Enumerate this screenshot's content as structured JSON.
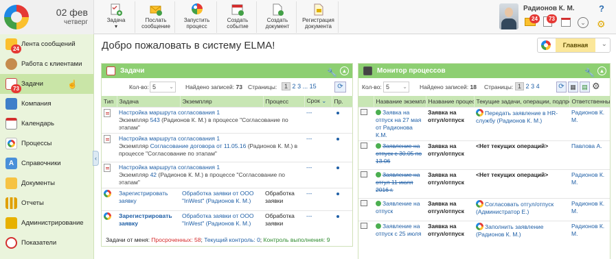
{
  "header": {
    "date_day": "02 фев",
    "date_weekday": "четверг",
    "tools": [
      {
        "label": "Задача",
        "sub": "▾"
      },
      {
        "label": "Послать сообщение"
      },
      {
        "label": "Запустить процесс"
      },
      {
        "label": "Создать событие"
      },
      {
        "label": "Создать документ"
      },
      {
        "label": "Регистрация документа"
      }
    ],
    "user_name": "Радионов К. М.",
    "badges": {
      "messages": "24",
      "tasks": "73"
    },
    "help": "?"
  },
  "sidebar": {
    "items": [
      {
        "label": "Лента сообщений",
        "badge": "24"
      },
      {
        "label": "Работа с клиентами"
      },
      {
        "label": "Задачи",
        "badge": "73"
      },
      {
        "label": "Компания"
      },
      {
        "label": "Календарь"
      },
      {
        "label": "Процессы"
      },
      {
        "label": "Справочники"
      },
      {
        "label": "Документы"
      },
      {
        "label": "Отчеты"
      },
      {
        "label": "Администрирование"
      },
      {
        "label": "Показатели"
      }
    ]
  },
  "main": {
    "welcome": "Добро пожаловать в систему ELMA!",
    "home_label": "Главная"
  },
  "tasks_panel": {
    "title": "Задачи",
    "count_label": "Кол-во:",
    "count_value": "5",
    "found_label": "Найдено записей:",
    "found_value": "73",
    "pages_label": "Страницы:",
    "pages": [
      "1",
      "2",
      "3",
      "...",
      "15"
    ],
    "columns": [
      "Тип",
      "Задача",
      "Экземпляр",
      "Процесс",
      "Срок",
      "Пр."
    ],
    "rows": [
      {
        "task": "Настройка маршрута согласования 1",
        "detail_pre": "Экземпляр ",
        "detail_link": "543",
        "detail_mid": " (Радионов К. М.) в процессе \"Согласование по этапам\"",
        "instance": "",
        "process": "",
        "term": "---"
      },
      {
        "task": "Настройка маршрута согласования 1",
        "detail_pre": "Экземпляр ",
        "detail_link": "Согласование договора от 11.05.16",
        "detail_mid": " (Радионов К. М.) в процессе \"Согласование по этапам\"",
        "instance": "",
        "process": "",
        "term": "---"
      },
      {
        "task": "Настройка маршрута согласования 1",
        "detail_pre": "Экземпляр ",
        "detail_link": "42",
        "detail_mid": " (Радионов К. М.) в процессе \"Согласование по этапам\"",
        "instance": "",
        "process": "",
        "term": "---"
      },
      {
        "task": "Зарегистрировать заявку",
        "instance": "Обработка заявки от ООО \"InWest\" (Радионов К. М.)",
        "process": "Обработка заявки",
        "term": "---"
      },
      {
        "task": "Зарегистрировать заявку",
        "instance": "Обработка заявки от ООО \"InWest\" (Радионов К. М.)",
        "process": "Обработка заявки",
        "term": "---"
      }
    ],
    "footer": {
      "prefix": "Задачи от меня: ",
      "overdue": "Просроченных: 58",
      "control": "Текущий контроль: 0",
      "done": "Контроль выполнения: 9"
    }
  },
  "monitor_panel": {
    "title": "Монитор процессов",
    "count_label": "Кол-во:",
    "count_value": "5",
    "found_label": "Найдено записей:",
    "found_value": "18",
    "pages_label": "Страницы:",
    "pages": [
      "1",
      "2",
      "3",
      "4"
    ],
    "columns": [
      "Название экземпляра",
      "Название процесса",
      "Текущие задачи, операции, подпроцессы",
      "Ответственный"
    ],
    "rows": [
      {
        "instance": "Заявка на отпуск на 27 мая от Радионова К.М.",
        "strike": false,
        "process": "Заявка на отгул/отпуск",
        "current": "Передать заявление в HR-службу (Радионов К. М.)",
        "ring": true,
        "owner": "Радионов К. М."
      },
      {
        "instance": "Заявление на отпуск с 30.05 по 13.06",
        "strike": true,
        "process": "Заявка на отгул/отпуск",
        "current": "<Нет текущих операций>",
        "ring": false,
        "owner": "Павлова А."
      },
      {
        "instance": "Заявление на отгул 11 июля 2016 г.",
        "strike": true,
        "process": "Заявка на отгул/отпуск",
        "current": "<Нет текущих операций>",
        "ring": false,
        "owner": "Радионов К. М."
      },
      {
        "instance": "Заявление на отпуск",
        "strike": false,
        "process": "Заявка на отгул/отпуск",
        "current": "Согласовать отгул/отпуск (Администратор Е.)",
        "ring": true,
        "owner": "Радионов К. М."
      },
      {
        "instance": "Заявление на отпуск с 25 июля",
        "strike": false,
        "process": "Заявка на отгул/отпуск",
        "current": "Заполнить заявление (Радионов К. М.)",
        "ring": true,
        "owner": "Радионов К. М."
      }
    ]
  }
}
